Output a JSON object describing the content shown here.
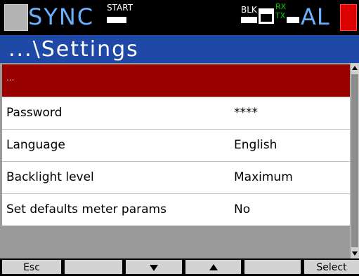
{
  "status_bar": {
    "mode": "SYNC",
    "start_label": "START",
    "blk_label": "BLK",
    "rx_label": "RX",
    "tx_label": "TX",
    "al_label": "AL"
  },
  "title": "...\\Settings",
  "list": {
    "rows": [
      {
        "label": "...",
        "value": "",
        "selected": true
      },
      {
        "label": "Password",
        "value": "****"
      },
      {
        "label": "Language",
        "value": "English"
      },
      {
        "label": "Backlight level",
        "value": "Maximum"
      },
      {
        "label": "Set defaults meter params",
        "value": "No"
      }
    ]
  },
  "softkeys": {
    "esc": "Esc",
    "blank1": "",
    "down_icon": "down-arrow-icon",
    "up_icon": "up-arrow-icon",
    "blank2": "",
    "select": "Select"
  },
  "colors": {
    "sync_text": "#6ab0ff",
    "title_bar": "#1f49a6",
    "selected_row": "#990000",
    "alarm": "#dd0000",
    "rx_tx": "#00d000"
  }
}
